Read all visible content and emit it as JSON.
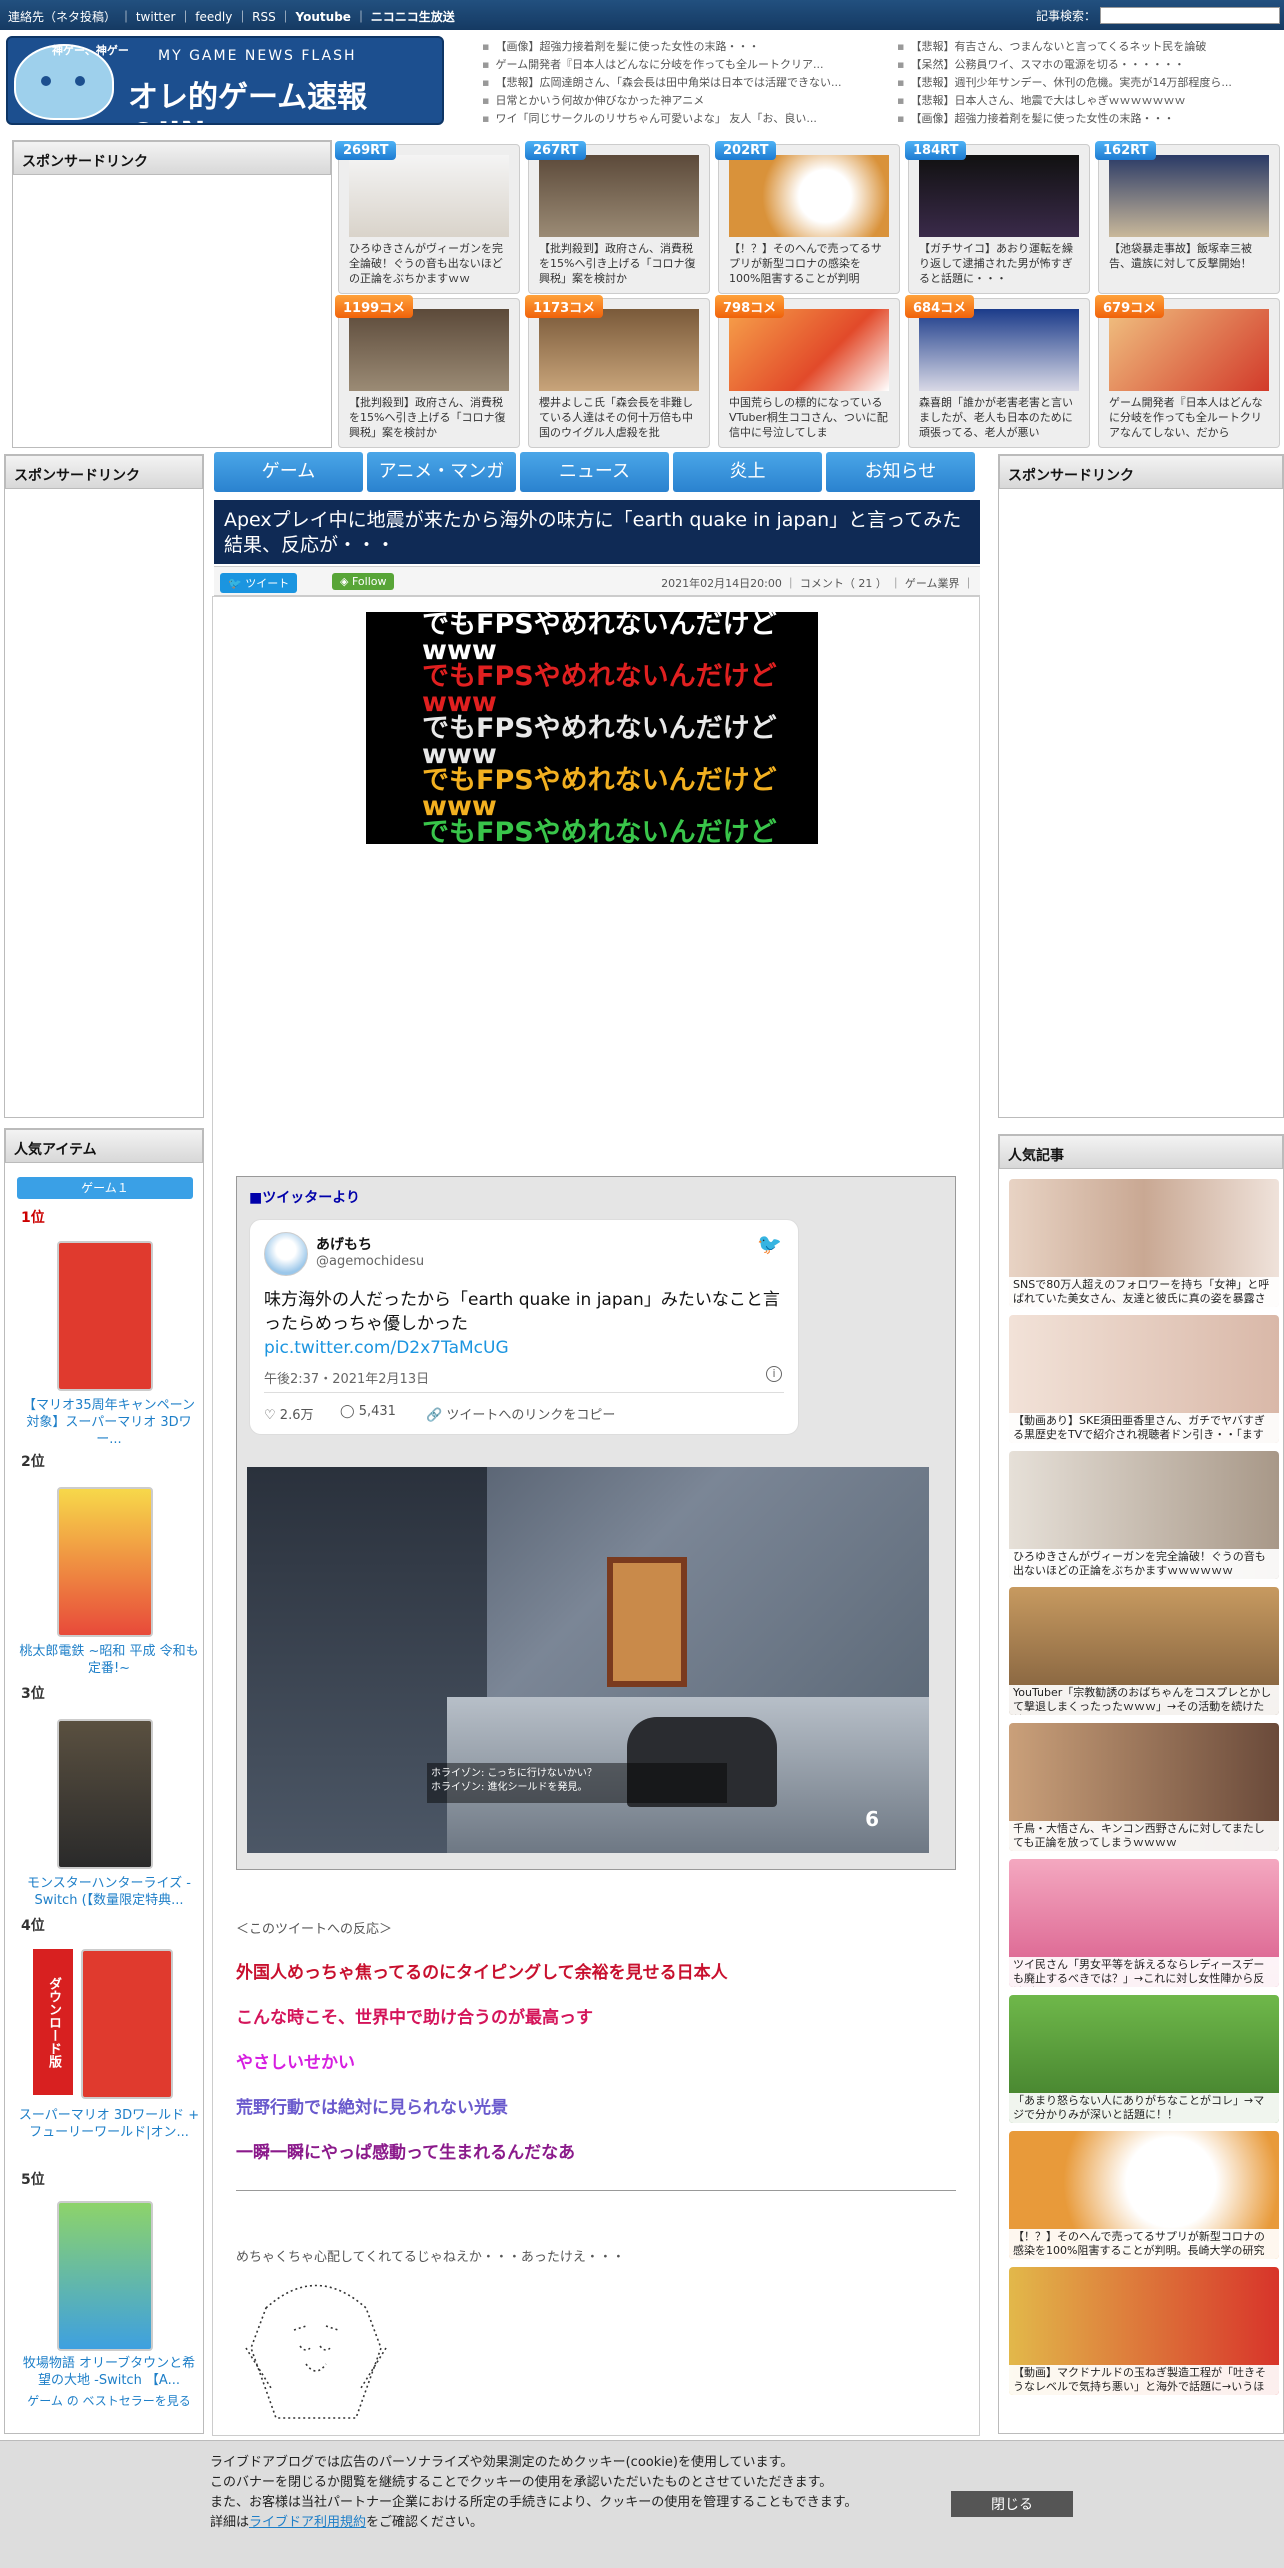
{
  "topbar": {
    "links": [
      "連絡先（ネタ投稿）",
      "twitter",
      "feedly",
      "RSS",
      "Youtube",
      "ニコニコ生放送"
    ],
    "search_label": "記事検索："
  },
  "logo": {
    "kami": "神ゲー、神ゲー",
    "sub": "MY GAME NEWS FLASH",
    "title": "オレ的ゲーム速報@JIN"
  },
  "headlines_left": [
    "【画像】超強力接着剤を髪に使った女性の末路・・・",
    "ゲーム開発者『日本人はどんなに分岐を作っても全ルートクリア...",
    "【悲報】広岡達朗さん、「森会長は田中角栄は日本では活躍できない...",
    "日常とかいう何故か伸びなかった神アニメ",
    "ワイ「同じサークルのリサちゃん可愛いよな」 友人「お、良い..."
  ],
  "headlines_right": [
    "【悲報】有吉さん、つまんないと言ってくるネット民を論破",
    "【呆然】公務員ワイ、スマホの電源を切る・・・・・・",
    "【悲報】週刊少年サンデー、休刊の危機。実売が14万部程度ら...",
    "【悲報】日本人さん、地震で大はしゃぎｗｗｗｗｗｗｗ",
    "【画像】超強力接着剤を髪に使った女性の末路・・・"
  ],
  "sponsor_label": "スポンサードリンク",
  "cards": [
    {
      "badge": "269RT",
      "type": "rt",
      "text": "ひろゆきさんがヴィーガンを完全論破！ぐうの音も出ないほどの正論をぶちかますｗｗ"
    },
    {
      "badge": "267RT",
      "type": "rt",
      "text": "【批判殺到】政府さん、消費税を15%へ引き上げる「コロナ復興税」案を検討か"
    },
    {
      "badge": "202RT",
      "type": "rt",
      "text": "【！？】そのへんで売ってるサプリが新型コロナの感染を100%阻害することが判明"
    },
    {
      "badge": "184RT",
      "type": "rt",
      "text": "【ガチサイコ】あおり運転を繰り返して逮捕された男が怖すぎると話題に・・・"
    },
    {
      "badge": "162RT",
      "type": "rt",
      "text": "【池袋暴走事故】飯塚幸三被告、遺族に対して反撃開始！"
    },
    {
      "badge": "1199コメ",
      "type": "cm",
      "text": "【批判殺到】政府さん、消費税を15%へ引き上げる「コロナ復興税」案を検討か"
    },
    {
      "badge": "1173コメ",
      "type": "cm",
      "text": "櫻井よしこ氏「森会長を非難している人達はその何十万倍も中国のウイグル人虐殺を批"
    },
    {
      "badge": "798コメ",
      "type": "cm",
      "text": "中国荒らしの標的になっているVTuber桐生ココさん、ついに配信中に号泣してしま"
    },
    {
      "badge": "684コメ",
      "type": "cm",
      "text": "森喜朗「誰かが老害老害と言いましたが、老人も日本のために頑張ってる、老人が悪い"
    },
    {
      "badge": "679コメ",
      "type": "cm",
      "text": "ゲーム開発者『日本人はどんなに分岐を作っても全ルートクリアなんてしない、だから"
    }
  ],
  "nav": [
    "ゲーム",
    "アニメ・マンガ",
    "ニュース",
    "炎上",
    "お知らせ"
  ],
  "article": {
    "title": "Apexプレイ中に地震が来たから海外の味方に「earth quake in japan」と言ってみた結果、反応が・・・",
    "tweet_btn": "ツイート",
    "follow_btn": "Follow",
    "meta": "2021年02月14日20:00 ｜ コメント（ 21 ） ｜ ゲーム業界 ｜"
  },
  "video_lines": [
    "でもFPSやめれないんだけどwww",
    "でもFPSやめれないんだけどwww",
    "でもFPSやめれないんだけどwww",
    "でもFPSやめれないんだけどwww",
    "でもFPSやめれないんだけどwww",
    "でもFPSやめれないんだけどwww",
    "でもFPSやめれないんだけどwww",
    "でもFPSやめれないんだけどwww"
  ],
  "video_colors": [
    "#ffffff",
    "#e02020",
    "#e8e8e8",
    "#f2b020",
    "#39c54a",
    "#3aa0f0",
    "#2844e0",
    "#ffffff"
  ],
  "twitter_label": "■ツイッターより",
  "tweet": {
    "name": "あげもち",
    "handle": "@agemochidesu",
    "text": "味方海外の人だったから「earth quake in japan」みたいなこと言ったらめっちゃ優しかった",
    "link": "pic.twitter.com/D2x7TaMcUG",
    "time": "午後2:37・2021年2月13日",
    "likes": "2.6万",
    "replies": "5,431",
    "copy": "ツイートへのリンクをコピー"
  },
  "game_overlay": {
    "chat": "ホライゾン: こっちに行けないかい？",
    "chat2": "ホライゾン: 進化シールドを発見。",
    "ammo": "6"
  },
  "reactions_head": "＜このツイートへの反応＞",
  "reactions": [
    {
      "text": "外国人めっちゃ焦ってるのにタイピングして余裕を見せる日本人",
      "color": "#c8102e"
    },
    {
      "text": "こんな時こそ、世界中で助け合うのが最高っす",
      "color": "#d4145a"
    },
    {
      "text": "やさしいせかい",
      "color": "#d61ee0"
    },
    {
      "text": "荒野行動では絶対に見られない光景",
      "color": "#6a5acd"
    },
    {
      "text": "一瞬一瞬にやっぱ感動って生まれるんだなあ",
      "color": "#8b1a8b"
    }
  ],
  "aa_caption": "めちゃくちゃ心配してくれてるじゃねえか・・・あったけえ・・・",
  "aa_art": "　 ／￣￣＼\n　/　　＿ノ　＼\n　|　　（ ●）（●）\n. |　　　（__人__）\n　 |　　　 ｀ ⌒´ﾉ\n　. |　　　　　 }\n　. ヽ　　　　 }\n　　 ヽ　　　ノ",
  "popular_items_label": "人気アイテム",
  "game_tab": "ゲーム１",
  "items": [
    {
      "rank": "1位",
      "title": "【マリオ35周年キャンペーン対象】スーパーマリオ 3Dワー..."
    },
    {
      "rank": "2位",
      "title": "桃太郎電鉄 ~昭和 平成 令和も定番!~"
    },
    {
      "rank": "3位",
      "title": "モンスターハンターライズ -Switch (【数量限定特典..."
    },
    {
      "rank": "4位",
      "title": "スーパーマリオ 3Dワールド + フューリーワールド|オン..."
    },
    {
      "rank": "5位",
      "title": "牧場物語 オリーブタウンと希望の大地 -Switch 【A..."
    }
  ],
  "bestseller": "ゲーム の ベストセラーを見る",
  "download_label": "ダウンロード版",
  "popular_articles_label": "人気記事",
  "articles": [
    "SNSで80万人超えのフォロワーを持ち「女神」と呼ばれていた美女さん、友達と彼氏に真の姿を暴露される",
    "【動画あり】SKE須田亜香里さん、ガチでヤバすぎる黒歴史をTVで紹介され視聴者ドン引き・・「ますwww",
    "ひろゆきさんがヴィーガンを完全論破！ぐうの音も出ないほどの正論をぶちかますｗｗｗｗｗｗ",
    "YouTuber「宗教勧誘のおばちゃんをコスプレとかして撃退しまくったったｗｗｗ」→その活動を続けた結果",
    "千鳥・大悟さん、キンコン西野さんに対してまたしても正論を放ってしまうｗｗｗｗ",
    "ツイ民さん「男女平等を訴えるならレディースデーも廃止するべきでは？」→これに対し女性陣から反論が",
    "「あまり怒らない人にありがちなことがコレ」→マジで分かりみが深いと話題に！！",
    "【！？】そのへんで売ってるサプリが新型コロナの感染を100%阻害することが判明。長崎大学の研究",
    "【動画】マクドナルドの玉ねぎ製造工程が「吐きそうなレベルで気持ち悪い」と海外で話題に→いうほど？"
  ],
  "cookie": {
    "lines": [
      "ライブドアブログでは広告のパーソナライズや効果測定のためクッキー(cookie)を使用しています。",
      "このバナーを閉じるか閲覧を継続することでクッキーの使用を承認いただいたものとさせていただきます。",
      "また、お客様は当社パートナー企業における所定の手続きにより、クッキーの使用を管理することもできます。"
    ],
    "detail_pre": "詳細は",
    "detail_link": "ライブドア利用規約",
    "detail_post": "をご確認ください。",
    "close": "閉じる"
  }
}
